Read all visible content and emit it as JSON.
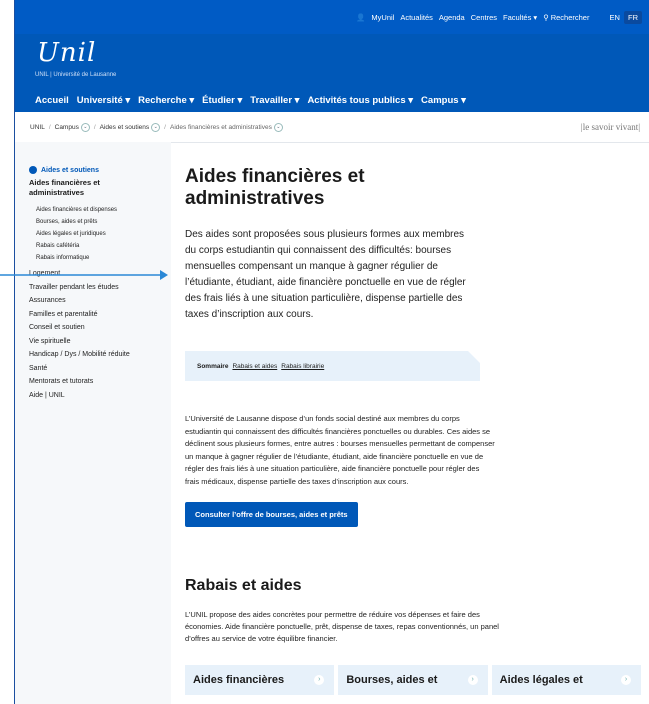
{
  "top_nav": [
    "MyUnil",
    "Actualités",
    "Agenda",
    "Centres",
    "Facultés ▾",
    "Rechercher"
  ],
  "lang": [
    "EN",
    "FR"
  ],
  "brand": {
    "logo": "Unil",
    "sub": "UNIL | Université de Lausanne"
  },
  "main_nav": [
    "Accueil",
    "Université ▾",
    "Recherche ▾",
    "Étudier ▾",
    "Travailler ▾",
    "Activités tous publics ▾",
    "Campus ▾"
  ],
  "breadcrumb": [
    "UNIL",
    "Campus",
    "Aides et soutiens",
    "Aides financières et administratives"
  ],
  "motto": "|le savoir vivant|",
  "sidebar": {
    "parent": "Aides et soutiens",
    "current": "Aides financières et administratives",
    "sub": [
      "Aides financières et dispenses",
      "Bourses, aides et prêts",
      "Aides légales et juridiques",
      "Rabais cafétéria",
      "Rabais informatique"
    ],
    "items": [
      "Logement",
      "Travailler pendant les études",
      "Assurances",
      "Familles et parentalité",
      "Conseil et soutien",
      "Vie spirituelle",
      "Handicap / Dys / Mobilité réduite",
      "Santé",
      "Mentorats et tutorats",
      "Aide | UNIL"
    ]
  },
  "page": {
    "title": "Aides financières et administratives",
    "lead": "Des aides sont proposées sous plusieurs formes aux membres du corps estudiantin qui connaissent des difficultés: bourses mensuelles compensant un manque à gagner régulier de l’étudiante, étudiant, aide financière ponctuelle en vue de régler des frais liés à une situation particulière, dispense partielle des taxes d’inscription aux cours.",
    "sommaire_label": "Sommaire",
    "sommaire_links": [
      "Rabais et aides",
      "Rabais librairie"
    ],
    "body": "L’Université de Lausanne dispose d’un fonds social destiné aux membres du corps estudiantin qui connaissent des difficultés financières ponctuelles ou durables. Ces aides se déclinent sous plusieurs formes, entre autres : bourses mensuelles permettant de compenser un manque à gagner régulier de l’étudiante, étudiant, aide financière ponctuelle en vue de régler des frais liés à une situation particulière, aide financière ponctuelle pour régler des frais médicaux, dispense partielle des taxes d’inscription aux cours.",
    "button": "Consulter l’offre de bourses, aides et prêts",
    "section_title": "Rabais et aides",
    "section_body": "L’UNIL propose des aides concrètes pour permettre de réduire vos dépenses et faire des économies. Aide financière ponctuelle, prêt, dispense de taxes, repas conventionnés, un panel d’offres au service de votre équilibre financier.",
    "cards": [
      "Aides financières",
      "Bourses, aides et",
      "Aides légales et"
    ]
  }
}
